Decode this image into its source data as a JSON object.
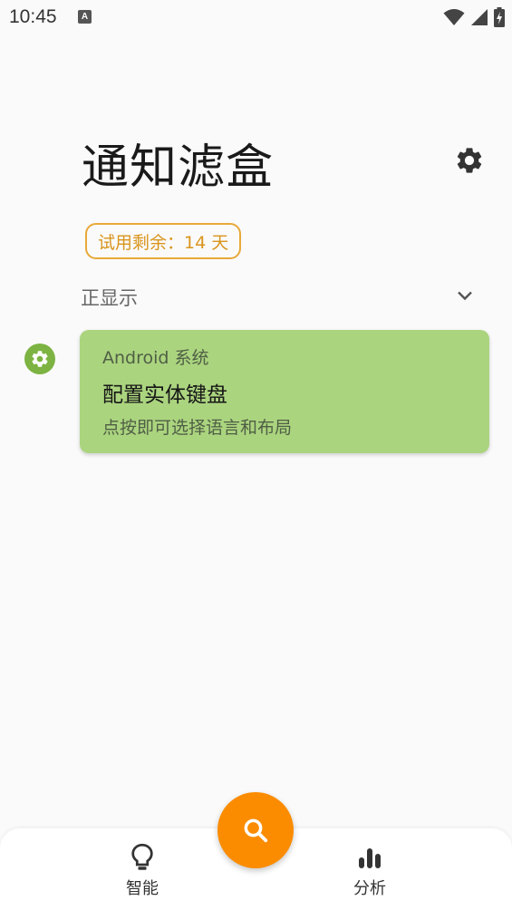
{
  "status_bar": {
    "time": "10:45",
    "app_icon_letter": "A",
    "icons": [
      "wifi-icon",
      "signal-icon",
      "battery-charging-icon"
    ]
  },
  "header": {
    "title": "通知滤盒",
    "settings_icon": "gear-icon"
  },
  "trial": {
    "label": "试用剩余：14 天",
    "color": "#d9951c"
  },
  "section": {
    "label": "正显示",
    "chevron_icon": "chevron-down-icon"
  },
  "notifications": [
    {
      "app_name": "Android 系统",
      "title": "配置实体键盘",
      "text": "点按即可选择语言和布局",
      "app_icon": "gear-icon",
      "card_color": "#abd47f",
      "badge_color": "#7cb342"
    }
  ],
  "bottom_nav": {
    "items": [
      {
        "label": "智能",
        "icon": "lightbulb-icon"
      },
      {
        "label": "分析",
        "icon": "bar-chart-icon"
      }
    ],
    "fab_icon": "search-icon",
    "fab_color": "#fb8c00"
  }
}
